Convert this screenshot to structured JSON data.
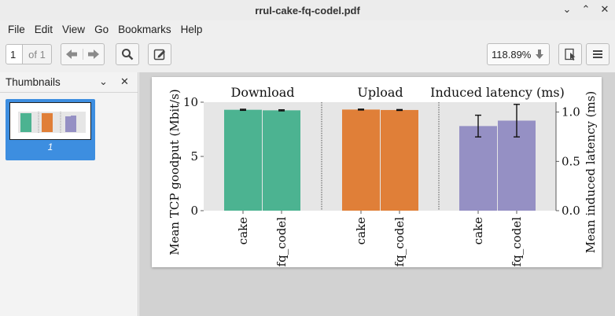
{
  "window": {
    "title": "rrul-cake-fq-codel.pdf",
    "controls": [
      "⌄",
      "⌃",
      "✕"
    ]
  },
  "menu": [
    "File",
    "Edit",
    "View",
    "Go",
    "Bookmarks",
    "Help"
  ],
  "toolbar": {
    "page_value": "1",
    "page_of": "of 1",
    "zoom": "118.89%"
  },
  "sidebar": {
    "title": "Thumbnails",
    "thumb_label": "1"
  },
  "chart_data": [
    {
      "type": "bar",
      "title": "Download",
      "categories": [
        "cake",
        "fq_codel"
      ],
      "values": [
        9.3,
        9.25
      ],
      "errors": [
        0.05,
        0.05
      ],
      "color": "#4cb391",
      "ylabel": "Mean TCP goodput (Mbit/s)",
      "ylim": [
        0,
        10
      ],
      "yticks": [
        "0",
        "5",
        "10"
      ]
    },
    {
      "type": "bar",
      "title": "Upload",
      "categories": [
        "cake",
        "fq_codel"
      ],
      "values": [
        9.32,
        9.28
      ],
      "errors": [
        0.04,
        0.04
      ],
      "color": "#e07f38",
      "ylim": [
        0,
        10
      ]
    },
    {
      "type": "bar",
      "title": "Induced latency (ms)",
      "categories": [
        "cake",
        "fq_codel"
      ],
      "values": [
        0.78,
        0.83
      ],
      "errors": [
        0.1,
        0.15
      ],
      "color": "#9590c4",
      "ylabel": "Mean induced latency (ms)",
      "ylim": [
        0,
        1.0
      ],
      "yticks": [
        "0.0",
        "0.5",
        "1.0"
      ]
    }
  ]
}
